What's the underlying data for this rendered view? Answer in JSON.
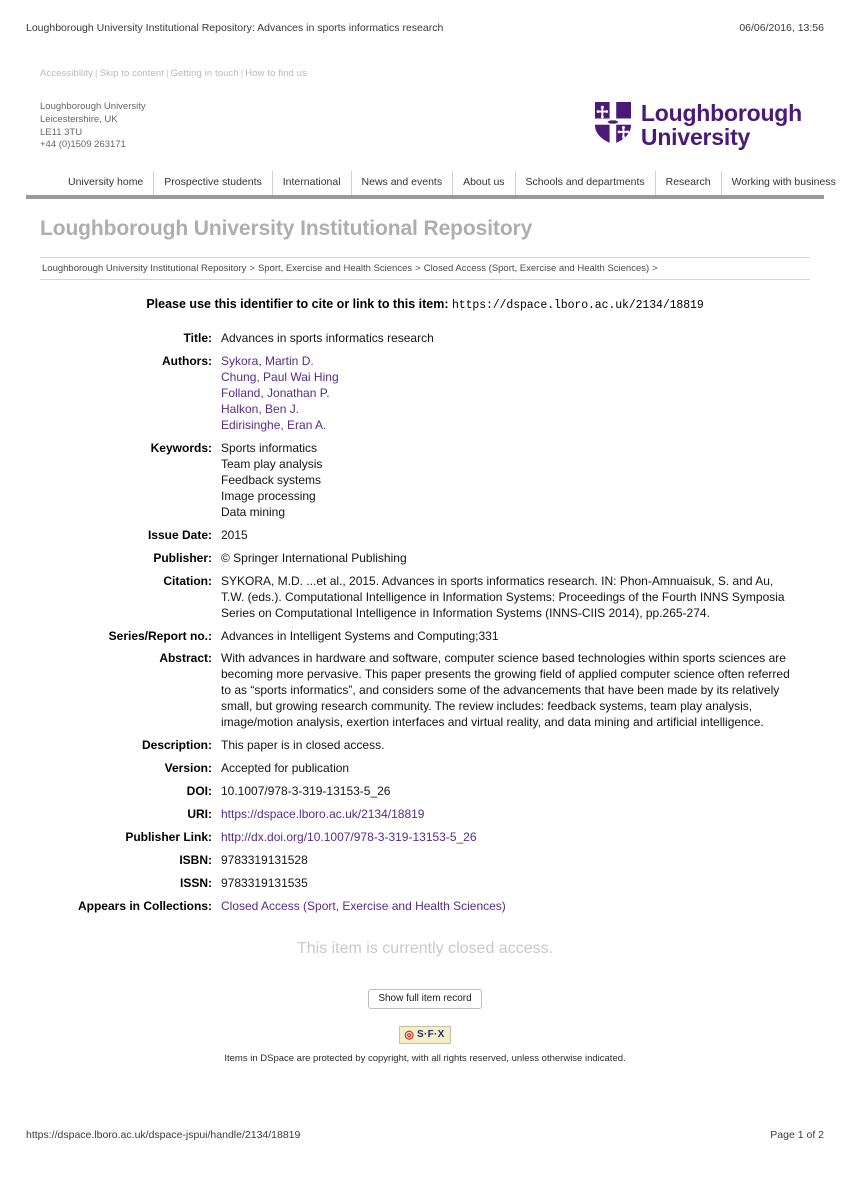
{
  "browser_print": {
    "header_title": "Loughborough University Institutional Repository: Advances in sports informatics research",
    "header_timestamp": "06/06/2016, 13:56",
    "footer_url": "https://dspace.lboro.ac.uk/dspace-jspui/handle/2134/18819",
    "footer_page": "Page 1 of 2"
  },
  "access_links": [
    "Accessibility",
    "Skip to content",
    "Getting in touch",
    "How to find us"
  ],
  "address": [
    "Loughborough University",
    "Leicestershire, UK",
    "LE11 3TU",
    "+44 (0)1509 263171"
  ],
  "logo": {
    "line1": "Loughborough",
    "line2": "University",
    "color": "#4b1a78"
  },
  "nav": {
    "items": [
      "University home",
      "Prospective students",
      "International",
      "News and events",
      "About us",
      "Schools and departments",
      "Research",
      "Working with business"
    ]
  },
  "repository": {
    "title": "Loughborough University Institutional Repository",
    "breadcrumb": [
      "Loughborough University Institutional Repository",
      "Sport, Exercise and Health Sciences",
      "Closed Access (Sport, Exercise and Health Sciences)"
    ],
    "breadcrumb_separator": ">",
    "breadcrumb_trailing": ">"
  },
  "identifier": {
    "prompt": "Please use this identifier to cite or link to this item:",
    "uri": "https://dspace.lboro.ac.uk/2134/18819"
  },
  "item": {
    "labels": {
      "title": "Title:",
      "authors": "Authors:",
      "keywords": "Keywords:",
      "issue_date": "Issue Date:",
      "publisher": "Publisher:",
      "citation": "Citation:",
      "series": "Series/Report no.:",
      "abstract": "Abstract:",
      "description": "Description:",
      "version": "Version:",
      "doi": "DOI:",
      "uri": "URI:",
      "publisher_link": "Publisher Link:",
      "isbn": "ISBN:",
      "issn": "ISSN:",
      "collections": "Appears in Collections:"
    },
    "title": "Advances in sports informatics research",
    "authors": [
      "Sykora, Martin D.",
      "Chung, Paul Wai Hing",
      "Folland, Jonathan P.",
      "Halkon, Ben J.",
      "Edirisinghe, Eran A."
    ],
    "keywords": [
      "Sports informatics",
      "Team play analysis",
      "Feedback systems",
      "Image processing",
      "Data mining"
    ],
    "issue_date": "2015",
    "publisher": "© Springer International Publishing",
    "citation": "SYKORA, M.D. ...et al., 2015. Advances in sports informatics research. IN: Phon-Amnuaisuk, S. and Au, T.W. (eds.). Computational Intelligence in Information Systems: Proceedings of the Fourth INNS Symposia Series on Computational Intelligence in Information Systems (INNS-CIIS 2014), pp.265-274.",
    "series": "Advances in Intelligent Systems and Computing;331",
    "abstract": "With advances in hardware and software, computer science based technologies within sports sciences are becoming more pervasive. This paper presents the growing field of applied computer science often referred to as “sports informatics”, and considers some of the advancements that have been made by its relatively small, but growing research community. The review includes: feedback systems, team play analysis, image/motion analysis, exertion interfaces and virtual reality, and data mining and artificial intelligence.",
    "description": "This paper is in closed access.",
    "version": "Accepted for publication",
    "doi": "10.1007/978-3-319-13153-5_26",
    "uri": "https://dspace.lboro.ac.uk/2134/18819",
    "publisher_link": "http://dx.doi.org/10.1007/978-3-319-13153-5_26",
    "isbn": "9783319131528",
    "issn": "9783319131535",
    "collections": "Closed Access (Sport, Exercise and Health Sciences)",
    "link_color": "#5b2a86"
  },
  "notice": {
    "closed_access": "This item is currently closed access."
  },
  "actions": {
    "show_full_record": "Show full item record",
    "sfx_mark": "◎",
    "sfx_label": "S·F·X"
  },
  "copyright": "Items in DSpace are protected by copyright, with all rights reserved, unless otherwise indicated."
}
